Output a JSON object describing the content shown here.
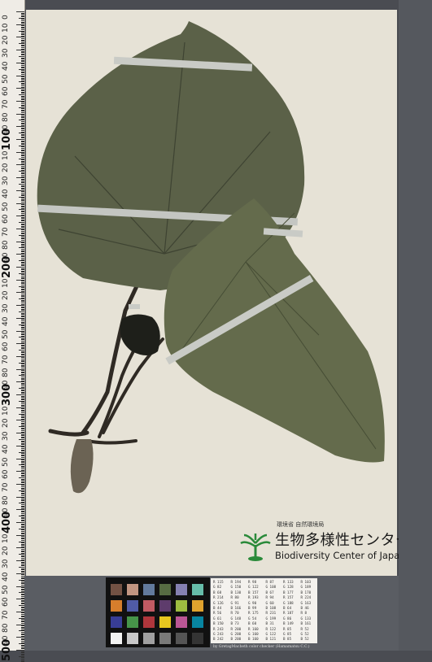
{
  "ruler": {
    "big_labels": [
      "100",
      "200",
      "300",
      "400",
      "500"
    ],
    "labels": [
      "0",
      "10",
      "20",
      "30",
      "40",
      "50",
      "60",
      "70",
      "80",
      "90",
      "100",
      "10",
      "20",
      "30",
      "40",
      "50",
      "60",
      "70",
      "80",
      "90",
      "200",
      "10",
      "20",
      "30",
      "40",
      "50",
      "60",
      "70",
      "80",
      "90",
      "300",
      "10",
      "20",
      "30",
      "40",
      "50",
      "60",
      "70",
      "80",
      "90",
      "400",
      "10",
      "20",
      "30",
      "40",
      "50",
      "60",
      "70",
      "80",
      "90",
      "500"
    ]
  },
  "logo": {
    "org": "環境省 自然環境局",
    "name_jp": "生物多様性センター",
    "name_en": "Biodiversity Center of Japan",
    "color": "#2a8a3a"
  },
  "color_card": {
    "rows": [
      [
        "R 115",
        "R 194",
        "R 98",
        "R 87",
        "R 133",
        "R 103"
      ],
      [
        "G 82",
        "G 150",
        "G 122",
        "G 108",
        "G 128",
        "G 189"
      ],
      [
        "B 68",
        "B 130",
        "B 157",
        "B 67",
        "B 177",
        "B 170"
      ],
      [
        "R 214",
        "R 80",
        "R 193",
        "R 94",
        "R 157",
        "R 224"
      ],
      [
        "G 126",
        "G 91",
        "G 90",
        "G 60",
        "G 188",
        "G 163"
      ],
      [
        "B 44",
        "B 166",
        "B 99",
        "B 108",
        "B 64",
        "B 46"
      ],
      [
        "R 56",
        "R 70",
        "R 175",
        "R 231",
        "R 187",
        "R 8"
      ],
      [
        "G 61",
        "G 148",
        "G 54",
        "G 199",
        "G 86",
        "G 133"
      ],
      [
        "B 150",
        "B 73",
        "B 60",
        "B 31",
        "B 149",
        "B 161"
      ],
      [
        "R 243",
        "R 200",
        "R 160",
        "R 122",
        "R 85",
        "R 52"
      ],
      [
        "G 243",
        "G 200",
        "G 160",
        "G 122",
        "G 85",
        "G 52"
      ],
      [
        "B 242",
        "B 200",
        "B 160",
        "B 121",
        "B 85",
        "B 52"
      ]
    ],
    "footer": "by GretagMacbeth color checker (Hamamatsu C.C.)"
  },
  "swatch_colors": [
    "#735244",
    "#c29682",
    "#627a9d",
    "#576c43",
    "#8580b1",
    "#67bdaa",
    "#d67e2c",
    "#505ba6",
    "#c15a63",
    "#5e3c6c",
    "#9dbc40",
    "#e0a32e",
    "#383d96",
    "#469449",
    "#af363c",
    "#e7c71f",
    "#bb5695",
    "#0885a1",
    "#f3f3f2",
    "#c8c8c8",
    "#a0a0a0",
    "#7a7a79",
    "#555555",
    "#343434"
  ]
}
